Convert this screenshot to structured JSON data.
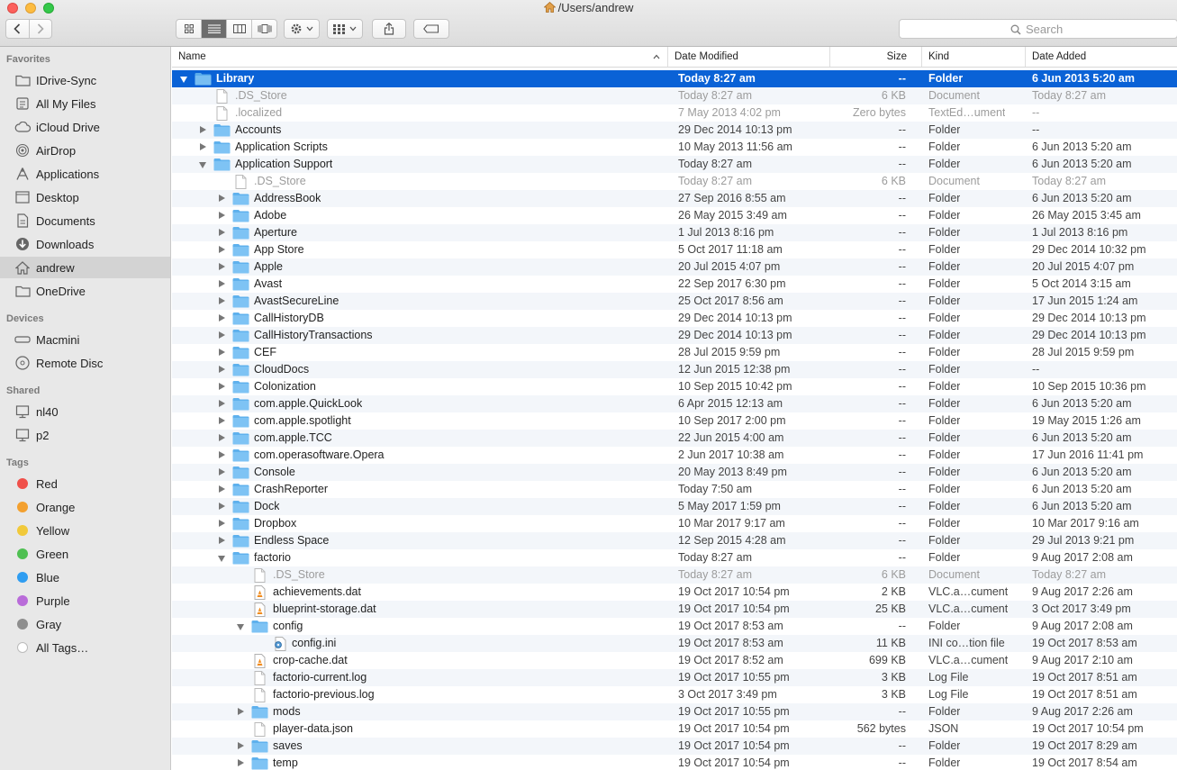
{
  "window": {
    "title": "/Users/andrew"
  },
  "toolbar": {
    "search_placeholder": "Search"
  },
  "sidebar": {
    "sections": [
      {
        "header": "Favorites",
        "items": [
          {
            "label": "IDrive-Sync",
            "icon": "folder-icon"
          },
          {
            "label": "All My Files",
            "icon": "all-files-icon"
          },
          {
            "label": "iCloud Drive",
            "icon": "cloud-icon"
          },
          {
            "label": "AirDrop",
            "icon": "airdrop-icon"
          },
          {
            "label": "Applications",
            "icon": "applications-icon"
          },
          {
            "label": "Desktop",
            "icon": "desktop-icon"
          },
          {
            "label": "Documents",
            "icon": "documents-icon"
          },
          {
            "label": "Downloads",
            "icon": "downloads-icon"
          },
          {
            "label": "andrew",
            "icon": "home-icon",
            "selected": true
          },
          {
            "label": "OneDrive",
            "icon": "folder-icon"
          }
        ]
      },
      {
        "header": "Devices",
        "items": [
          {
            "label": "Macmini",
            "icon": "macmini-icon"
          },
          {
            "label": "Remote Disc",
            "icon": "disc-icon"
          }
        ]
      },
      {
        "header": "Shared",
        "items": [
          {
            "label": "nl40",
            "icon": "monitor-icon"
          },
          {
            "label": "p2",
            "icon": "monitor-icon"
          }
        ]
      },
      {
        "header": "Tags",
        "items": [
          {
            "label": "Red",
            "color": "#f0504a"
          },
          {
            "label": "Orange",
            "color": "#f3a02f"
          },
          {
            "label": "Yellow",
            "color": "#f1c93a"
          },
          {
            "label": "Green",
            "color": "#4fc052"
          },
          {
            "label": "Blue",
            "color": "#2f9df1"
          },
          {
            "label": "Purple",
            "color": "#b96cd9"
          },
          {
            "label": "Gray",
            "color": "#8e8e8e"
          },
          {
            "label": "All Tags…",
            "color": "all"
          }
        ]
      }
    ]
  },
  "columns": [
    "Name",
    "Date Modified",
    "Size",
    "Kind",
    "Date Added"
  ],
  "rows": [
    {
      "depth": 0,
      "disclosure": "open",
      "icon": "folder",
      "name": "Library",
      "modified": "Today 8:27 am",
      "size": "--",
      "kind": "Folder",
      "added": "6 Jun 2013 5:20 am",
      "selected": true
    },
    {
      "depth": 1,
      "disclosure": "none",
      "icon": "doc",
      "name": ".DS_Store",
      "modified": "Today 8:27 am",
      "size": "6 KB",
      "kind": "Document",
      "added": "Today 8:27 am",
      "dim": true
    },
    {
      "depth": 1,
      "disclosure": "none",
      "icon": "doc",
      "name": ".localized",
      "modified": "7 May 2013 4:02 pm",
      "size": "Zero bytes",
      "kind": "TextEd…ument",
      "added": "--",
      "dim": true
    },
    {
      "depth": 1,
      "disclosure": "closed",
      "icon": "folder",
      "name": "Accounts",
      "modified": "29 Dec 2014 10:13 pm",
      "size": "--",
      "kind": "Folder",
      "added": "--"
    },
    {
      "depth": 1,
      "disclosure": "closed",
      "icon": "folder",
      "name": "Application Scripts",
      "modified": "10 May 2013 11:56 am",
      "size": "--",
      "kind": "Folder",
      "added": "6 Jun 2013 5:20 am"
    },
    {
      "depth": 1,
      "disclosure": "open",
      "icon": "folder",
      "name": "Application Support",
      "modified": "Today 8:27 am",
      "size": "--",
      "kind": "Folder",
      "added": "6 Jun 2013 5:20 am"
    },
    {
      "depth": 2,
      "disclosure": "none",
      "icon": "doc",
      "name": ".DS_Store",
      "modified": "Today 8:27 am",
      "size": "6 KB",
      "kind": "Document",
      "added": "Today 8:27 am",
      "dim": true
    },
    {
      "depth": 2,
      "disclosure": "closed",
      "icon": "folder",
      "name": "AddressBook",
      "modified": "27 Sep 2016 8:55 am",
      "size": "--",
      "kind": "Folder",
      "added": "6 Jun 2013 5:20 am"
    },
    {
      "depth": 2,
      "disclosure": "closed",
      "icon": "folder",
      "name": "Adobe",
      "modified": "26 May 2015 3:49 am",
      "size": "--",
      "kind": "Folder",
      "added": "26 May 2015 3:45 am"
    },
    {
      "depth": 2,
      "disclosure": "closed",
      "icon": "folder",
      "name": "Aperture",
      "modified": "1 Jul 2013 8:16 pm",
      "size": "--",
      "kind": "Folder",
      "added": "1 Jul 2013 8:16 pm"
    },
    {
      "depth": 2,
      "disclosure": "closed",
      "icon": "folder",
      "name": "App Store",
      "modified": "5 Oct 2017 11:18 am",
      "size": "--",
      "kind": "Folder",
      "added": "29 Dec 2014 10:32 pm"
    },
    {
      "depth": 2,
      "disclosure": "closed",
      "icon": "folder",
      "name": "Apple",
      "modified": "20 Jul 2015 4:07 pm",
      "size": "--",
      "kind": "Folder",
      "added": "20 Jul 2015 4:07 pm"
    },
    {
      "depth": 2,
      "disclosure": "closed",
      "icon": "folder",
      "name": "Avast",
      "modified": "22 Sep 2017 6:30 pm",
      "size": "--",
      "kind": "Folder",
      "added": "5 Oct 2014 3:15 am"
    },
    {
      "depth": 2,
      "disclosure": "closed",
      "icon": "folder",
      "name": "AvastSecureLine",
      "modified": "25 Oct 2017 8:56 am",
      "size": "--",
      "kind": "Folder",
      "added": "17 Jun 2015 1:24 am"
    },
    {
      "depth": 2,
      "disclosure": "closed",
      "icon": "folder",
      "name": "CallHistoryDB",
      "modified": "29 Dec 2014 10:13 pm",
      "size": "--",
      "kind": "Folder",
      "added": "29 Dec 2014 10:13 pm"
    },
    {
      "depth": 2,
      "disclosure": "closed",
      "icon": "folder",
      "name": "CallHistoryTransactions",
      "modified": "29 Dec 2014 10:13 pm",
      "size": "--",
      "kind": "Folder",
      "added": "29 Dec 2014 10:13 pm"
    },
    {
      "depth": 2,
      "disclosure": "closed",
      "icon": "folder",
      "name": "CEF",
      "modified": "28 Jul 2015 9:59 pm",
      "size": "--",
      "kind": "Folder",
      "added": "28 Jul 2015 9:59 pm"
    },
    {
      "depth": 2,
      "disclosure": "closed",
      "icon": "folder",
      "name": "CloudDocs",
      "modified": "12 Jun 2015 12:38 pm",
      "size": "--",
      "kind": "Folder",
      "added": "--"
    },
    {
      "depth": 2,
      "disclosure": "closed",
      "icon": "folder",
      "name": "Colonization",
      "modified": "10 Sep 2015 10:42 pm",
      "size": "--",
      "kind": "Folder",
      "added": "10 Sep 2015 10:36 pm"
    },
    {
      "depth": 2,
      "disclosure": "closed",
      "icon": "folder",
      "name": "com.apple.QuickLook",
      "modified": "6 Apr 2015 12:13 am",
      "size": "--",
      "kind": "Folder",
      "added": "6 Jun 2013 5:20 am"
    },
    {
      "depth": 2,
      "disclosure": "closed",
      "icon": "folder",
      "name": "com.apple.spotlight",
      "modified": "10 Sep 2017 2:00 pm",
      "size": "--",
      "kind": "Folder",
      "added": "19 May 2015 1:26 am"
    },
    {
      "depth": 2,
      "disclosure": "closed",
      "icon": "folder",
      "name": "com.apple.TCC",
      "modified": "22 Jun 2015 4:00 am",
      "size": "--",
      "kind": "Folder",
      "added": "6 Jun 2013 5:20 am"
    },
    {
      "depth": 2,
      "disclosure": "closed",
      "icon": "folder",
      "name": "com.operasoftware.Opera",
      "modified": "2 Jun 2017 10:38 am",
      "size": "--",
      "kind": "Folder",
      "added": "17 Jun 2016 11:41 pm"
    },
    {
      "depth": 2,
      "disclosure": "closed",
      "icon": "folder",
      "name": "Console",
      "modified": "20 May 2013 8:49 pm",
      "size": "--",
      "kind": "Folder",
      "added": "6 Jun 2013 5:20 am"
    },
    {
      "depth": 2,
      "disclosure": "closed",
      "icon": "folder",
      "name": "CrashReporter",
      "modified": "Today 7:50 am",
      "size": "--",
      "kind": "Folder",
      "added": "6 Jun 2013 5:20 am"
    },
    {
      "depth": 2,
      "disclosure": "closed",
      "icon": "folder",
      "name": "Dock",
      "modified": "5 May 2017 1:59 pm",
      "size": "--",
      "kind": "Folder",
      "added": "6 Jun 2013 5:20 am"
    },
    {
      "depth": 2,
      "disclosure": "closed",
      "icon": "folder",
      "name": "Dropbox",
      "modified": "10 Mar 2017 9:17 am",
      "size": "--",
      "kind": "Folder",
      "added": "10 Mar 2017 9:16 am"
    },
    {
      "depth": 2,
      "disclosure": "closed",
      "icon": "folder",
      "name": "Endless Space",
      "modified": "12 Sep 2015 4:28 am",
      "size": "--",
      "kind": "Folder",
      "added": "29 Jul 2013 9:21 pm"
    },
    {
      "depth": 2,
      "disclosure": "open",
      "icon": "folder",
      "name": "factorio",
      "modified": "Today 8:27 am",
      "size": "--",
      "kind": "Folder",
      "added": "9 Aug 2017 2:08 am"
    },
    {
      "depth": 3,
      "disclosure": "none",
      "icon": "doc",
      "name": ".DS_Store",
      "modified": "Today 8:27 am",
      "size": "6 KB",
      "kind": "Document",
      "added": "Today 8:27 am",
      "dim": true
    },
    {
      "depth": 3,
      "disclosure": "none",
      "icon": "vlc",
      "name": "achievements.dat",
      "modified": "19 Oct 2017 10:54 pm",
      "size": "2 KB",
      "kind": "VLC.a…cument",
      "added": "9 Aug 2017 2:26 am"
    },
    {
      "depth": 3,
      "disclosure": "none",
      "icon": "vlc",
      "name": "blueprint-storage.dat",
      "modified": "19 Oct 2017 10:54 pm",
      "size": "25 KB",
      "kind": "VLC.a…cument",
      "added": "3 Oct 2017 3:49 pm"
    },
    {
      "depth": 3,
      "disclosure": "open",
      "icon": "folder",
      "name": "config",
      "modified": "19 Oct 2017 8:53 am",
      "size": "--",
      "kind": "Folder",
      "added": "9 Aug 2017 2:08 am"
    },
    {
      "depth": 4,
      "disclosure": "none",
      "icon": "ini",
      "name": "config.ini",
      "modified": "19 Oct 2017 8:53 am",
      "size": "11 KB",
      "kind": "INI co…tion file",
      "added": "19 Oct 2017 8:53 am"
    },
    {
      "depth": 3,
      "disclosure": "none",
      "icon": "vlc",
      "name": "crop-cache.dat",
      "modified": "19 Oct 2017 8:52 am",
      "size": "699 KB",
      "kind": "VLC.a…cument",
      "added": "9 Aug 2017 2:10 am"
    },
    {
      "depth": 3,
      "disclosure": "none",
      "icon": "doc",
      "name": "factorio-current.log",
      "modified": "19 Oct 2017 10:55 pm",
      "size": "3 KB",
      "kind": "Log File",
      "added": "19 Oct 2017 8:51 am"
    },
    {
      "depth": 3,
      "disclosure": "none",
      "icon": "doc",
      "name": "factorio-previous.log",
      "modified": "3 Oct 2017 3:49 pm",
      "size": "3 KB",
      "kind": "Log File",
      "added": "19 Oct 2017 8:51 am"
    },
    {
      "depth": 3,
      "disclosure": "closed",
      "icon": "folder",
      "name": "mods",
      "modified": "19 Oct 2017 10:55 pm",
      "size": "--",
      "kind": "Folder",
      "added": "9 Aug 2017 2:26 am"
    },
    {
      "depth": 3,
      "disclosure": "none",
      "icon": "doc",
      "name": "player-data.json",
      "modified": "19 Oct 2017 10:54 pm",
      "size": "562 bytes",
      "kind": "JSON",
      "added": "19 Oct 2017 10:54 pm"
    },
    {
      "depth": 3,
      "disclosure": "closed",
      "icon": "folder",
      "name": "saves",
      "modified": "19 Oct 2017 10:54 pm",
      "size": "--",
      "kind": "Folder",
      "added": "19 Oct 2017 8:29 am"
    },
    {
      "depth": 3,
      "disclosure": "closed",
      "icon": "folder",
      "name": "temp",
      "modified": "19 Oct 2017 10:54 pm",
      "size": "--",
      "kind": "Folder",
      "added": "19 Oct 2017 8:54 am"
    }
  ]
}
